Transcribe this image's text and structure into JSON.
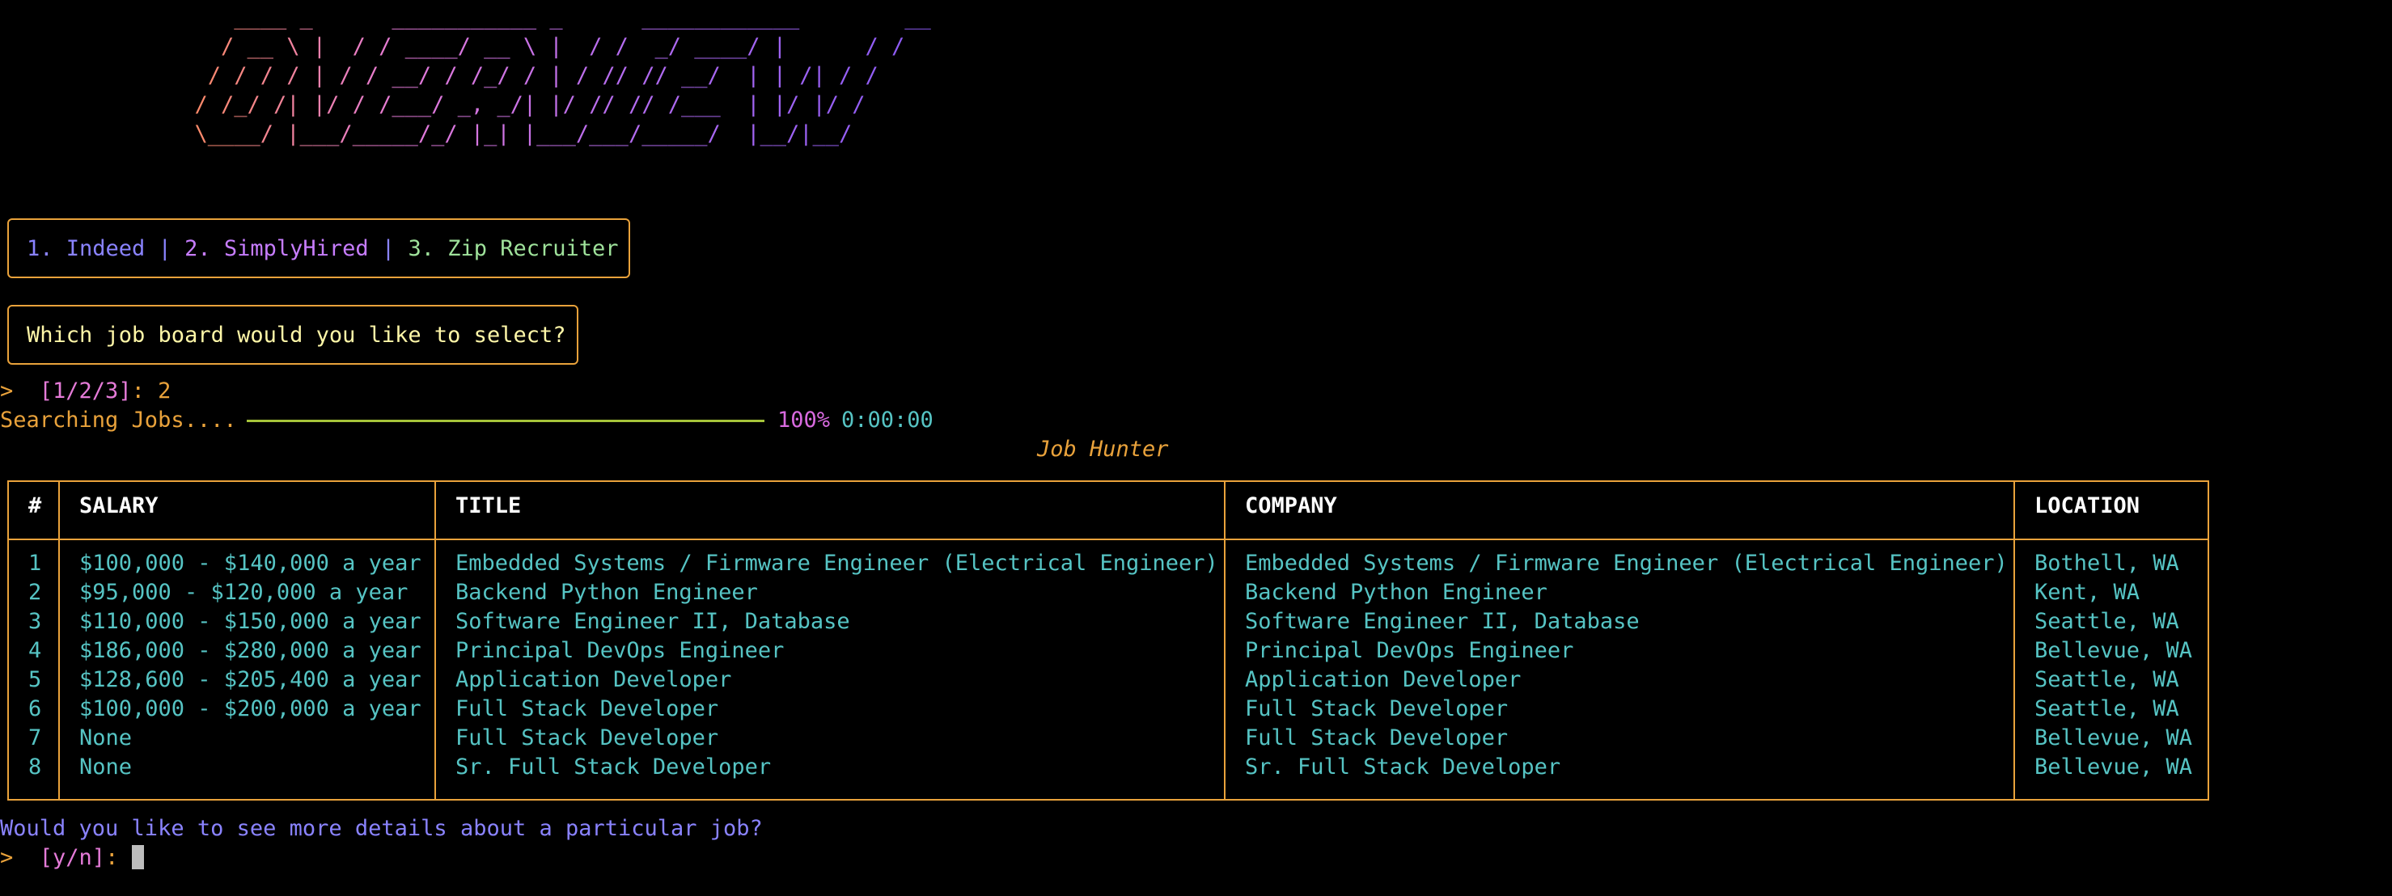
{
  "banner": {
    "lines": [
      "     ____ _      ___________ _      ____________        __",
      "    / __ \\ |  / / ____/ __ \\ |  / /  _/ ____/ |      / /",
      "   / / / / | / / __/ / /_/ / | / // // __/  | | /| / / ",
      "  / /_/ /| |/ / /___/ _, _/| |/ // // /___  | |/ |/ /  ",
      "  \\____/ |___/_____/_/ |_| |___/___/_____/  |__/|__/   "
    ]
  },
  "boards": {
    "item1": "1. Indeed",
    "sep1": " | ",
    "item2": "2. SimplyHired",
    "sep2": " | ",
    "item3": "3. Zip Recruiter"
  },
  "question": "Which job board would you like to select?",
  "select_prompt": {
    "arrow": ">",
    "choices": "[1/2/3]",
    "colon": ":",
    "answer": "2"
  },
  "progress": {
    "label": "Searching Jobs....",
    "value": 1.0,
    "percent_text": "100%",
    "time": "0:00:00"
  },
  "table": {
    "title": "Job Hunter",
    "columns": [
      "#",
      "SALARY",
      "TITLE",
      "COMPANY",
      "LOCATION"
    ],
    "rows": [
      {
        "num": "1",
        "salary": "$100,000 - $140,000 a year",
        "title": "Embedded Systems / Firmware Engineer (Electrical Engineer)",
        "company": "Embedded Systems / Firmware Engineer (Electrical Engineer)",
        "location": "Bothell, WA"
      },
      {
        "num": "2",
        "salary": "$95,000 - $120,000 a year",
        "title": "Backend Python Engineer",
        "company": "Backend Python Engineer",
        "location": "Kent, WA"
      },
      {
        "num": "3",
        "salary": "$110,000 - $150,000 a year",
        "title": "Software Engineer II, Database",
        "company": "Software Engineer II, Database",
        "location": "Seattle, WA"
      },
      {
        "num": "4",
        "salary": "$186,000 - $280,000 a year",
        "title": "Principal DevOps Engineer",
        "company": "Principal DevOps Engineer",
        "location": "Bellevue, WA"
      },
      {
        "num": "5",
        "salary": "$128,600 - $205,400 a year",
        "title": "Application Developer",
        "company": "Application Developer",
        "location": "Seattle, WA"
      },
      {
        "num": "6",
        "salary": "$100,000 - $200,000 a year",
        "title": "Full Stack Developer",
        "company": "Full Stack Developer",
        "location": "Seattle, WA"
      },
      {
        "num": "7",
        "salary": "None",
        "title": "Full Stack Developer",
        "company": "Full Stack Developer",
        "location": "Bellevue, WA"
      },
      {
        "num": "8",
        "salary": "None",
        "title": "Sr. Full Stack Developer",
        "company": "Sr. Full Stack Developer",
        "location": "Bellevue, WA"
      }
    ]
  },
  "details_question": "Would you like to see more details about a particular job?",
  "yn_prompt": {
    "arrow": ">",
    "choices": "[y/n]",
    "colon": ":"
  },
  "colors": {
    "border": "#e9a23b",
    "cell_text": "#56c4c4",
    "progress_bar": "#a6c43a"
  }
}
